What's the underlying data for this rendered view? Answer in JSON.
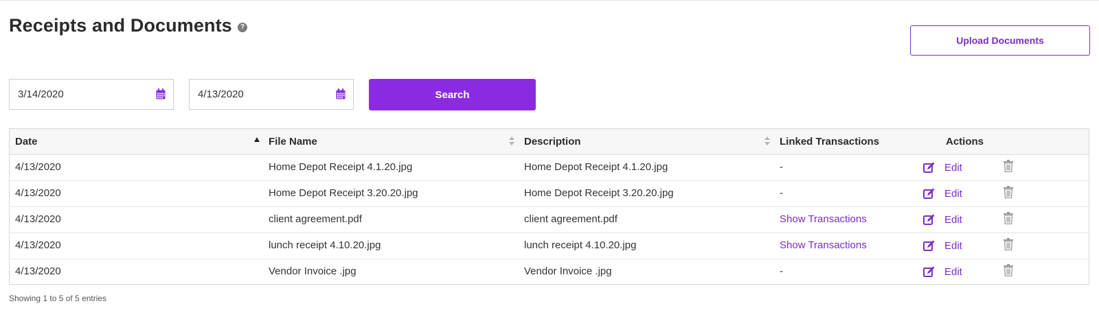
{
  "page": {
    "title": "Receipts and Documents",
    "help_icon": "question-circle-icon",
    "upload_label": "Upload Documents"
  },
  "filters": {
    "start_date": "3/14/2020",
    "end_date": "4/13/2020",
    "calendar_icon": "calendar-icon",
    "search_label": "Search"
  },
  "table": {
    "columns": [
      "Date",
      "File Name",
      "Description",
      "Linked Transactions",
      "Actions"
    ],
    "sort": {
      "column": "Date",
      "direction": "ascending"
    },
    "rows": [
      {
        "date": "4/13/2020",
        "file_name": "Home Depot Receipt 4.1.20.jpg",
        "description": "Home Depot Receipt 4.1.20.jpg",
        "linked": "-",
        "edit": "Edit"
      },
      {
        "date": "4/13/2020",
        "file_name": "Home Depot Receipt 3.20.20.jpg",
        "description": "Home Depot Receipt 3.20.20.jpg",
        "linked": "-",
        "edit": "Edit"
      },
      {
        "date": "4/13/2020",
        "file_name": "client agreement.pdf",
        "description": "client agreement.pdf",
        "linked": "Show Transactions",
        "edit": "Edit"
      },
      {
        "date": "4/13/2020",
        "file_name": "lunch receipt 4.10.20.jpg",
        "description": "lunch receipt 4.10.20.jpg",
        "linked": "Show Transactions",
        "edit": "Edit"
      },
      {
        "date": "4/13/2020",
        "file_name": "Vendor Invoice .jpg",
        "description": "Vendor Invoice .jpg",
        "linked": "-",
        "edit": "Edit"
      }
    ],
    "info": "Showing 1 to 5 of 5 entries"
  },
  "colors": {
    "accent": "#8a2be2",
    "link": "#7b2cc4",
    "header_bg": "#f7f7f7",
    "icon_gray": "#9a9a9a"
  }
}
